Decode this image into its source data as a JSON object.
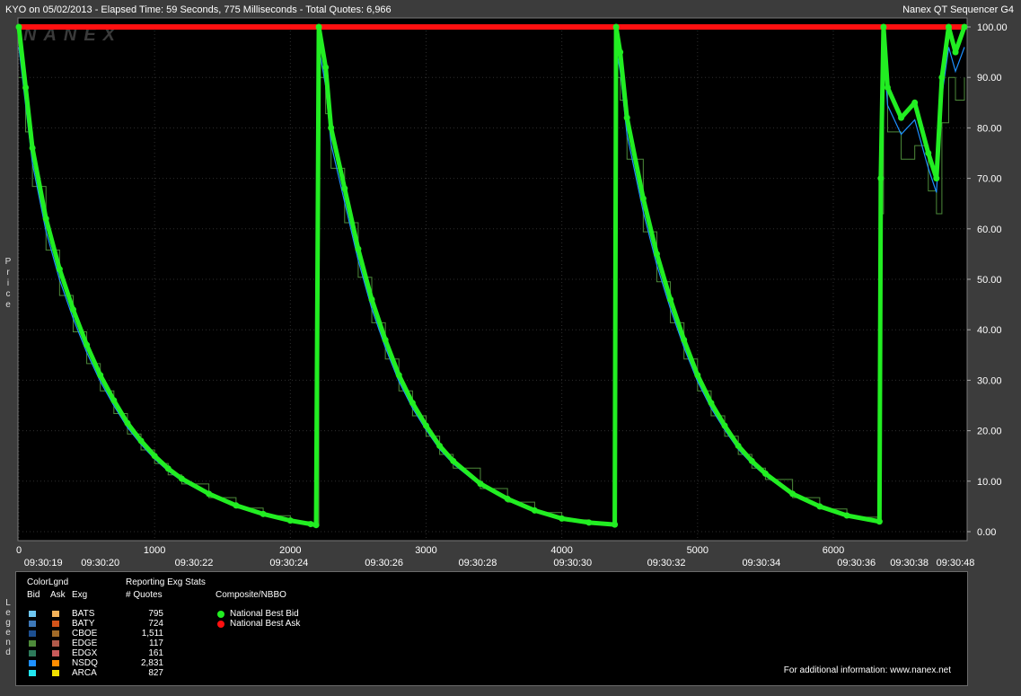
{
  "header": {
    "left": "KYO on 05/02/2013  -  Elapsed Time: 59 Seconds, 775 Milliseconds  -  Total Quotes: 6,966",
    "right": "Nanex QT Sequencer G4"
  },
  "watermark": "NANEX",
  "y_axis_label": "Price",
  "legend_side_label": "Legend",
  "legend": {
    "color_legend_title": "ColorLgnd",
    "bid_header": "Bid",
    "ask_header": "Ask",
    "exg_header": "Exg",
    "stats_title": "Reporting Exg Stats",
    "quotes_header": "# Quotes",
    "composite_title": "Composite/NBBO",
    "exchanges": [
      {
        "name": "BATS",
        "quotes": "795",
        "bid_color": "#6ec6f0",
        "ask_color": "#f5b35a"
      },
      {
        "name": "BATY",
        "quotes": "724",
        "bid_color": "#3d78b8",
        "ask_color": "#d2531a"
      },
      {
        "name": "CBOE",
        "quotes": "1,511",
        "bid_color": "#1c4f90",
        "ask_color": "#a06a28"
      },
      {
        "name": "EDGE",
        "quotes": "117",
        "bid_color": "#4d8a3a",
        "ask_color": "#b05a4a"
      },
      {
        "name": "EDGX",
        "quotes": "161",
        "bid_color": "#2d7a5a",
        "ask_color": "#c85a5a"
      },
      {
        "name": "NSDQ",
        "quotes": "2,831",
        "bid_color": "#1e90ff",
        "ask_color": "#ff8c00"
      },
      {
        "name": "ARCA",
        "quotes": "827",
        "bid_color": "#22e6f0",
        "ask_color": "#f0e000"
      }
    ],
    "nbbo": [
      {
        "label": "National Best Bid",
        "color": "#22ee22"
      },
      {
        "label": "National Best Ask",
        "color": "#ff1010"
      }
    ],
    "footer": "For additional information: www.nanex.net"
  },
  "chart_data": {
    "type": "line",
    "ylim": [
      0,
      100
    ],
    "xlim": [
      0,
      6966
    ],
    "y_ticks": [
      "0.00",
      "10.00",
      "20.00",
      "30.00",
      "40.00",
      "50.00",
      "60.00",
      "70.00",
      "80.00",
      "90.00",
      "100.00"
    ],
    "x_seq_ticks": [
      {
        "x": 0,
        "label": "0"
      },
      {
        "x": 1000,
        "label": "1000"
      },
      {
        "x": 2000,
        "label": "2000"
      },
      {
        "x": 3000,
        "label": "3000"
      },
      {
        "x": 4000,
        "label": "4000"
      },
      {
        "x": 5000,
        "label": "5000"
      },
      {
        "x": 6000,
        "label": "6000"
      }
    ],
    "x_time_ticks": [
      {
        "x": 180,
        "label": "09:30:19"
      },
      {
        "x": 600,
        "label": "09:30:20"
      },
      {
        "x": 1290,
        "label": "09:30:22"
      },
      {
        "x": 1990,
        "label": "09:30:24"
      },
      {
        "x": 2690,
        "label": "09:30:26"
      },
      {
        "x": 3380,
        "label": "09:30:28"
      },
      {
        "x": 4080,
        "label": "09:30:30"
      },
      {
        "x": 4770,
        "label": "09:30:32"
      },
      {
        "x": 5470,
        "label": "09:30:34"
      },
      {
        "x": 6170,
        "label": "09:30:36"
      },
      {
        "x": 6560,
        "label": "09:30:38"
      },
      {
        "x": 6900,
        "label": "09:30:48"
      }
    ],
    "series": [
      {
        "name": "National Best Ask",
        "x": [
          0,
          6966
        ],
        "y": [
          100,
          100
        ]
      },
      {
        "name": "National Best Bid",
        "x": [
          0,
          50,
          100,
          200,
          300,
          400,
          500,
          600,
          700,
          800,
          900,
          1000,
          1100,
          1200,
          1400,
          1600,
          1800,
          2000,
          2150,
          2190,
          2210,
          2260,
          2300,
          2400,
          2500,
          2600,
          2700,
          2800,
          2900,
          3000,
          3100,
          3200,
          3400,
          3600,
          3800,
          4000,
          4200,
          4390,
          4400,
          4430,
          4480,
          4600,
          4700,
          4800,
          4900,
          5000,
          5100,
          5200,
          5300,
          5400,
          5500,
          5700,
          5900,
          6100,
          6340,
          6350,
          6370,
          6400,
          6500,
          6600,
          6700,
          6760,
          6800,
          6850,
          6900,
          6966
        ],
        "y": [
          100,
          88,
          76,
          62,
          52,
          44,
          37,
          31,
          26,
          21.5,
          18,
          15,
          12.5,
          10.5,
          7.5,
          5.2,
          3.5,
          2.2,
          1.5,
          1.3,
          100,
          92,
          80,
          68,
          56,
          46,
          38,
          31,
          25.5,
          21,
          17,
          14,
          9.5,
          6.5,
          4.2,
          2.6,
          1.8,
          1.4,
          100,
          95,
          82,
          66,
          55,
          46,
          38,
          31,
          25.5,
          21,
          17,
          14,
          11.5,
          7.5,
          5,
          3.2,
          2,
          70,
          100,
          88,
          82,
          85,
          75,
          70,
          90,
          100,
          95,
          100
        ]
      }
    ]
  }
}
